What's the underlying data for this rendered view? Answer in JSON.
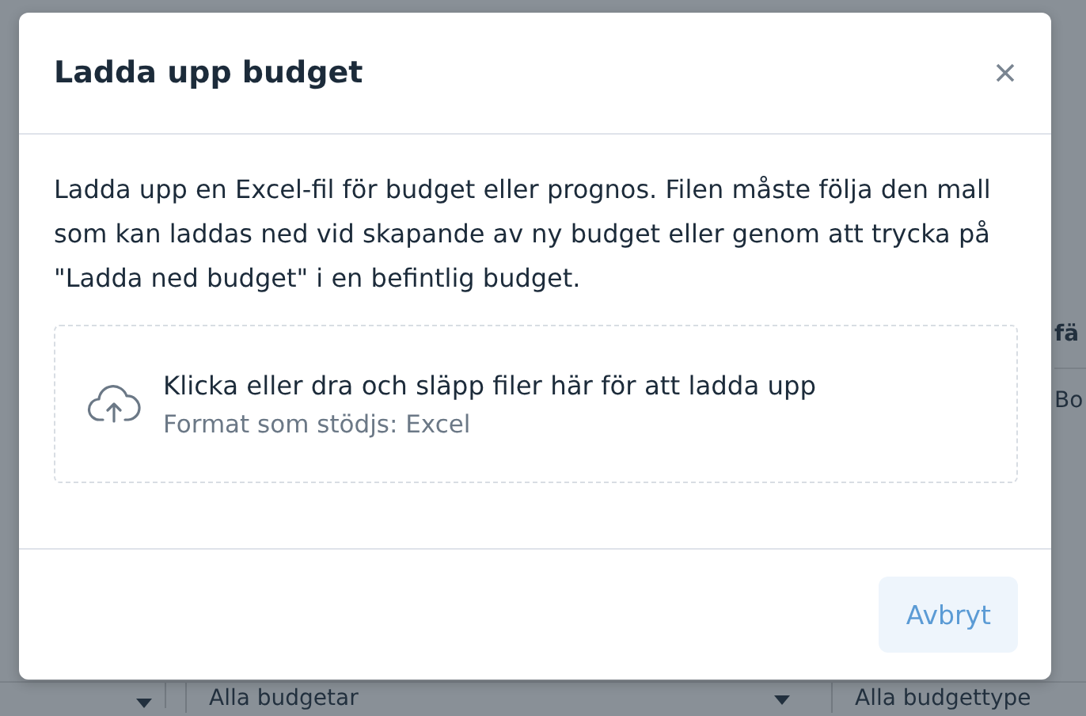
{
  "background": {
    "column_header": "fä",
    "cell": "Bo",
    "filters": [
      {
        "value": "Alla budgetar"
      },
      {
        "value": "Alla budgettype"
      }
    ]
  },
  "dialog": {
    "title": "Ladda upp budget",
    "description": "Ladda upp en Excel-fil för budget eller prognos. Filen måste följa den mall som kan laddas ned vid skapande av ny budget eller genom att trycka på \"Ladda ned budget\" i en befintlig budget.",
    "dropzone": {
      "prompt": "Klicka eller dra och släpp filer här för att ladda upp",
      "formats": "Format som stödjs: Excel"
    },
    "buttons": [
      "Avbryt"
    ]
  }
}
